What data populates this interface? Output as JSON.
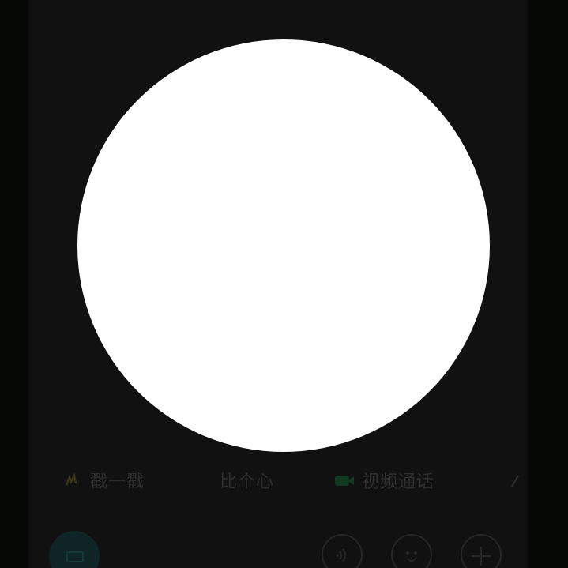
{
  "quick_actions": [
    {
      "label": "戳一戳",
      "icon": "poke-icon",
      "accent": "#3a3512"
    },
    {
      "label": "比个心",
      "icon": "heart-hand-icon",
      "accent": "#2e2e2e"
    },
    {
      "label": "视频通话",
      "icon": "video-call-icon",
      "accent": "#123a22"
    },
    {
      "label": "",
      "icon": "music-icon",
      "accent": "#2e2e2e"
    }
  ],
  "bottom_bar": {
    "keyboard_icon": "keyboard-icon",
    "voice_icon": "voice-icon",
    "emoji_icon": "emoji-icon",
    "plus_icon": "plus-icon"
  },
  "colors": {
    "background": "#060806",
    "panel": "#111111",
    "circle": "#ffffff"
  }
}
